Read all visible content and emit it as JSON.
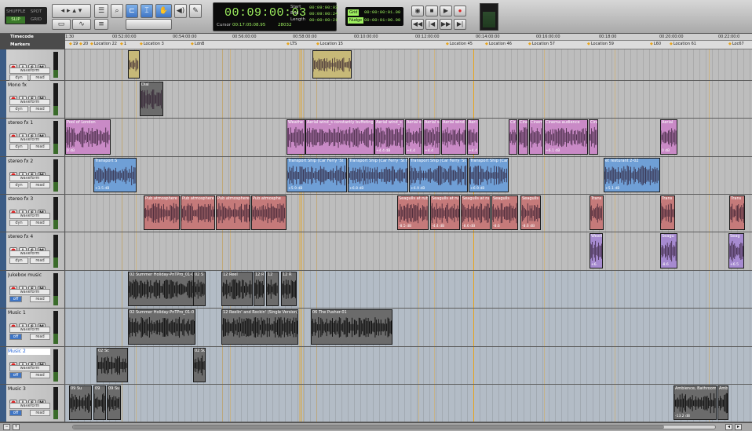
{
  "toolbar": {
    "edit_modes": [
      "SHUFFLE",
      "SPOT",
      "SLIP",
      "GRID"
    ],
    "active_mode": "SLIP",
    "tools": [
      "zoom-tool",
      "trim-tool",
      "selector-tool",
      "grabber-tool",
      "scrubber-tool",
      "pencil-tool"
    ],
    "main_counter": "00:09:00:03",
    "cursor_label": "Cursor",
    "cursor_value": "00:17:05:08.95",
    "cursor_extra": "28032",
    "start_label": "Start",
    "end_label": "End",
    "length_label": "Length",
    "start_value": "00:09:00:03",
    "end_value": "00:09:00:24",
    "length_value": "00:00:00:21",
    "grid_label": "Grid",
    "grid_value": "00:00:00:01.00",
    "nudge_label": "Nudge",
    "nudge_value": "00:00:01:00.00",
    "transport": [
      "rewind-icon",
      "stop-icon",
      "play-icon",
      "record-icon",
      "back-icon",
      "forward-icon"
    ]
  },
  "ruler": {
    "timecode_label": "Timecode",
    "markers_label": "Markers",
    "ticks": [
      "1:30",
      "00:52:00:00",
      "00:54:00:00",
      "00:56:00:00",
      "00:58:00:00",
      "00:10:00:00",
      "00:12:00:00",
      "00:14:00:00",
      "00:16:00:00",
      "00:18:00",
      "00:20:00:00",
      "00:22:00:0"
    ],
    "markers": [
      "19",
      "20",
      "Location 22",
      "1",
      "Location 3",
      "LdnB",
      "LTS",
      "Location 15",
      "Location 45",
      "Location 46",
      "Location 57",
      "Location 59",
      "L60",
      "Location 61",
      "Loc67"
    ]
  },
  "tracks": [
    {
      "name": "",
      "sel1": "waveform",
      "sel2": "dyn",
      "sel3": "read"
    },
    {
      "name": "Mono fx",
      "sel1": "waveform",
      "sel2": "dyn",
      "sel3": "read"
    },
    {
      "name": "stereo fx 1",
      "sel1": "waveform",
      "sel2": "dyn",
      "sel3": "read"
    },
    {
      "name": "stereo fx 2",
      "sel1": "waveform",
      "sel2": "dyn",
      "sel3": "read"
    },
    {
      "name": "stereo fx 3",
      "sel1": "waveform",
      "sel2": "dyn",
      "sel3": "read"
    },
    {
      "name": "stereo fx 4",
      "sel1": "waveform",
      "sel2": "dyn",
      "sel3": "read"
    },
    {
      "name": "Jukebox music",
      "sel1": "waveform",
      "sel2": "off",
      "sel3": "read"
    },
    {
      "name": "Music 1",
      "sel1": "waveform",
      "sel2": "off",
      "sel3": "read"
    },
    {
      "name": "Music 2",
      "sel1": "waveform",
      "sel2": "off",
      "sel3": "read"
    },
    {
      "name": "Music 3",
      "sel1": "waveform",
      "sel2": "off",
      "sel3": "read"
    }
  ],
  "clips": {
    "t1": [
      {
        "name": ""
      },
      {
        "name": ""
      }
    ],
    "t2": [
      {
        "name": "Dial"
      }
    ],
    "t3": [
      {
        "name": "Pool of London",
        "gain": "0 dB"
      },
      {
        "name": "Weathe",
        "gain": ""
      },
      {
        "name": "Aerial wind_s constantly buffeting",
        "gain": ""
      },
      {
        "name": "Aerial wind_s",
        "gain": "+4.4 dB"
      },
      {
        "name": "Aerial wi",
        "gain": "+4.4"
      },
      {
        "name": "Aerial wi",
        "gain": "+4.4"
      },
      {
        "name": "Aerial wind",
        "gain": ""
      },
      {
        "name": "Aeri",
        "gain": "+4.4"
      },
      {
        "name": "Cir",
        "gain": ""
      },
      {
        "name": "Cine",
        "gain": ""
      },
      {
        "name": "Cinem",
        "gain": ""
      },
      {
        "name": "Cinema audience",
        "gain": "+6.1 dB"
      },
      {
        "name": "Cine",
        "gain": ""
      },
      {
        "name": "Aerial",
        "gain": "0 dB"
      }
    ],
    "t4": [
      {
        "name": "Transport S",
        "gain": "+3.5 dB"
      },
      {
        "name": "Transport Ship (Car Ferry 'St",
        "gain": "+5.9 dB"
      },
      {
        "name": "Transport Ship (Car Ferry 'St F",
        "gain": "+6.8 dB"
      },
      {
        "name": "Transport Ship (Car Ferry 'St",
        "gain": "+6.9 dB"
      },
      {
        "name": "Transport Ship (Car",
        "gain": "+6.9 dB"
      },
      {
        "name": "et resturant 2-02",
        "gain": "+5.1 dB"
      }
    ],
    "t5": [
      {
        "name": "Pub atmosphere",
        "gain": ""
      },
      {
        "name": "Pub atmosphere",
        "gain": ""
      },
      {
        "name": "Pub atmosphere",
        "gain": ""
      },
      {
        "name": "Pub atmosphe",
        "gain": ""
      },
      {
        "name": "Seagulls at rubbish",
        "gain": "-8.5 dB"
      },
      {
        "name": "Seagulls at rubb",
        "gain": "-4.4 dB"
      },
      {
        "name": "Seagulls at ru",
        "gain": "-8.6 dB"
      },
      {
        "name": "Seagulls",
        "gain": "-8.6"
      },
      {
        "name": "Seagulls at ru",
        "gain": "-8.6 dB"
      },
      {
        "name": "Trans",
        "gain": ""
      },
      {
        "name": "Trans",
        "gain": ""
      },
      {
        "name": "Trans",
        "gain": ""
      }
    ],
    "t6": [
      {
        "name": "Weath",
        "gain": "+6."
      },
      {
        "name": "Seagu",
        "gain": "-8.6"
      },
      {
        "name": "Seag",
        "gain": "+6.5"
      }
    ],
    "t7": [
      {
        "name": "02 Summer Holiday-PnTPro_01-0",
        "gain": ""
      },
      {
        "name": "02 S",
        "gain": ""
      },
      {
        "name": "12 Reel",
        "gain": ""
      },
      {
        "name": "12 R",
        "gain": ""
      },
      {
        "name": "12",
        "gain": ""
      },
      {
        "name": "12 R",
        "gain": ""
      }
    ],
    "t8": [
      {
        "name": "02 Summer Holiday-PnTPro_01-0",
        "gain": ""
      },
      {
        "name": "12 Reelin' and Rockin' (Single Version)-",
        "gain": ""
      },
      {
        "name": "06 The Pusher-01",
        "gain": ""
      }
    ],
    "t9": [
      {
        "name": "02 Sc",
        "gain": ""
      },
      {
        "name": "02 Su",
        "gain": ""
      }
    ],
    "t10": [
      {
        "name": "09 Su",
        "gain": ""
      },
      {
        "name": "09",
        "gain": ""
      },
      {
        "name": "09 Su",
        "gain": ""
      },
      {
        "name": "Ambience, Bathroom",
        "gain": "-13.2 dB"
      },
      {
        "name": "Ambi",
        "gain": ""
      }
    ]
  },
  "colors": {
    "fx_pink": "#c98ac6",
    "fx_blue": "#6f9fd6",
    "fx_red": "#c57a7a",
    "fx_purple": "#a68ad0",
    "music_gray": "#6b6b6b",
    "yellow_clip": "#c7b978",
    "cue_line": "#e7a319"
  }
}
